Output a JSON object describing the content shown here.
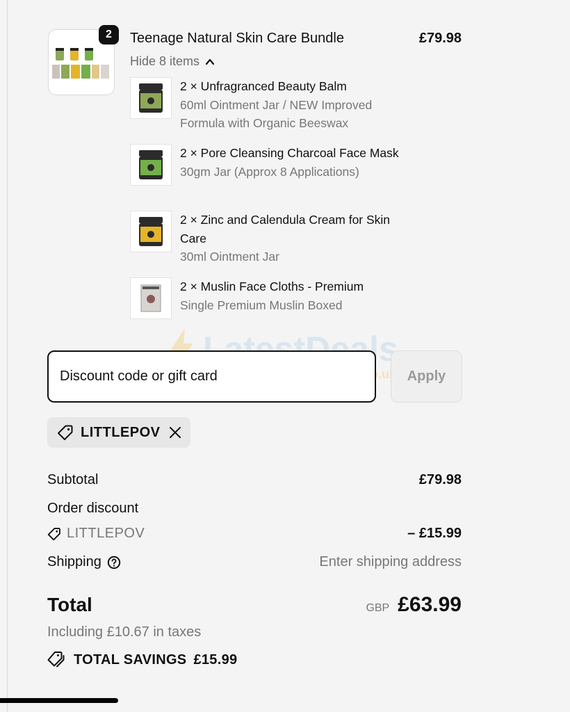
{
  "bundle": {
    "quantity": "2",
    "title": "Teenage Natural Skin Care Bundle",
    "price": "£79.98",
    "toggle_label": "Hide 8 items",
    "items": [
      {
        "name": "2 × Unfragranced Beauty Balm",
        "variant": "60ml Ointment Jar / NEW Improved Formula with Organic Beeswax",
        "jar_color": "#8ea857"
      },
      {
        "name": "2 × Pore Cleansing Charcoal Face Mask",
        "variant": "30gm Jar (Approx 8 Applications)",
        "jar_color": "#74b04a"
      },
      {
        "name": "2 × Zinc and Calendula Cream for Skin Care",
        "variant": "30ml Ointment Jar",
        "jar_color": "#e5b42b"
      },
      {
        "name": "2 × Muslin Face Cloths - Premium",
        "variant": "Single Premium Muslin Boxed",
        "jar_color": "#d8d4d0"
      }
    ]
  },
  "discount": {
    "placeholder": "Discount code or gift card",
    "apply_label": "Apply",
    "applied_code": "LITTLEPOV"
  },
  "summary": {
    "subtotal_label": "Subtotal",
    "subtotal_value": "£79.98",
    "order_discount_label": "Order discount",
    "discount_code": "LITTLEPOV",
    "discount_value": "– £15.99",
    "shipping_label": "Shipping",
    "shipping_value": "Enter shipping address",
    "total_label": "Total",
    "currency": "GBP",
    "total_value": "£63.99",
    "taxes_note": "Including £10.67 in taxes",
    "savings_label": "TOTAL SAVINGS",
    "savings_value": "£15.99"
  },
  "watermark": {
    "text": "LatestDeals",
    "sub": ".co.uk"
  }
}
